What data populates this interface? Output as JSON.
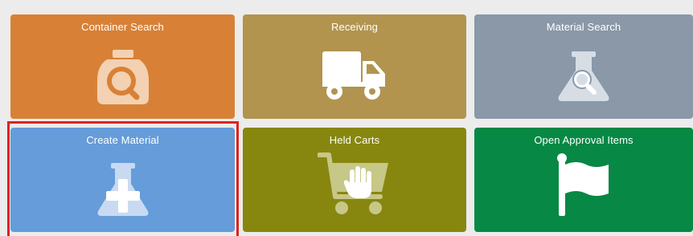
{
  "tiles": [
    {
      "id": "container-search",
      "label": "Container Search",
      "icon": "container-search-icon",
      "color": "#d88136"
    },
    {
      "id": "receiving",
      "label": "Receiving",
      "icon": "truck-icon",
      "color": "#b2944f"
    },
    {
      "id": "material-search",
      "label": "Material Search",
      "icon": "flask-search-icon",
      "color": "#8a98a8"
    },
    {
      "id": "create-material",
      "label": "Create Material",
      "icon": "flask-plus-icon",
      "color": "#659cd9",
      "selected": true
    },
    {
      "id": "held-carts",
      "label": "Held Carts",
      "icon": "cart-hand-icon",
      "color": "#878710"
    },
    {
      "id": "open-approval-items",
      "label": "Open Approval Items",
      "icon": "flag-icon",
      "color": "#078844"
    }
  ],
  "selection_color": "#e0211f"
}
